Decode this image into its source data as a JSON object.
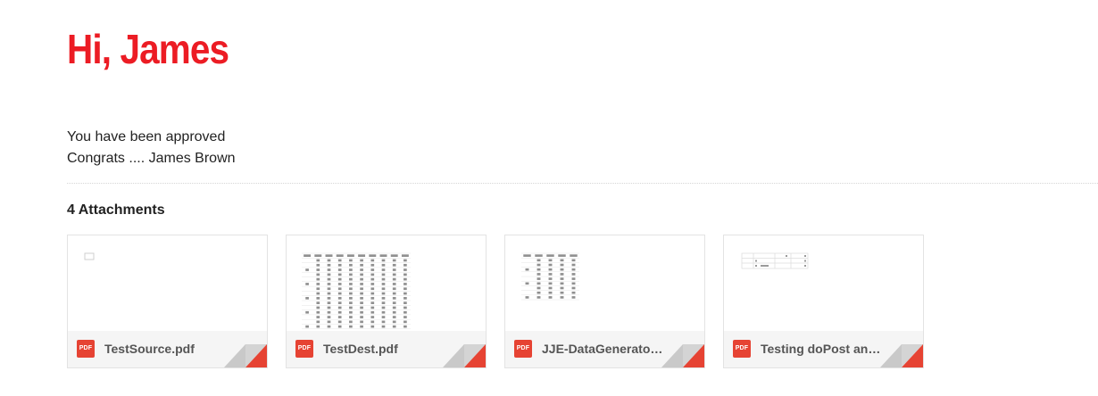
{
  "greeting": "Hi, James",
  "message": {
    "line1": "You have been approved",
    "line2": "Congrats .... James Brown"
  },
  "attachments": {
    "heading": "4 Attachments",
    "icon_label": "PDF",
    "items": [
      {
        "name": "TestSource.pdf"
      },
      {
        "name": "TestDest.pdf"
      },
      {
        "name": "JJE-DataGenerator…"
      },
      {
        "name": "Testing doPost and…"
      }
    ]
  },
  "colors": {
    "greeting": "#ec1c24",
    "pdf_icon": "#e64333",
    "corner_fold": "#e64333"
  }
}
